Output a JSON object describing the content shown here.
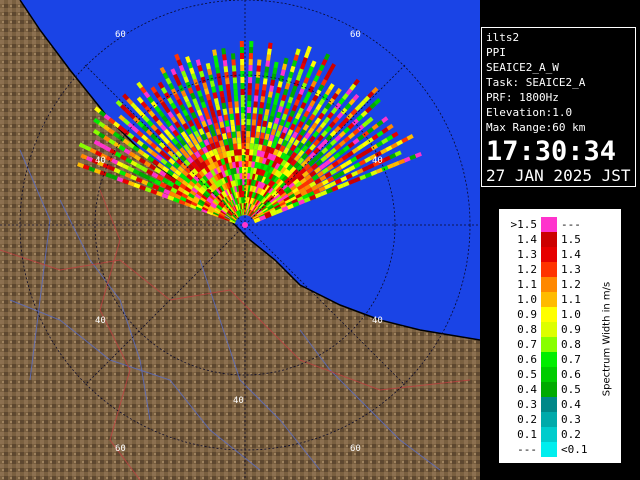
{
  "info": {
    "station": "ilts2",
    "scan_type": "PPI",
    "scan_name": "SEAICE2_A_W",
    "task": "Task: SEAICE2_A",
    "prf": "PRF: 1800Hz",
    "elevation": "Elevation:1.0",
    "max_range": "Max Range:60 km",
    "time": "17:30:34",
    "date": "27 JAN 2025 JST"
  },
  "legend": {
    "title": "Spectrum Width in m/s",
    "rows": [
      {
        "lo": ">1.5",
        "color": "#ff33cc",
        "hi": "---"
      },
      {
        "lo": "1.4",
        "color": "#cc0000",
        "hi": "1.5"
      },
      {
        "lo": "1.3",
        "color": "#e60000",
        "hi": "1.4"
      },
      {
        "lo": "1.2",
        "color": "#ff3300",
        "hi": "1.3"
      },
      {
        "lo": "1.1",
        "color": "#ff8800",
        "hi": "1.2"
      },
      {
        "lo": "1.0",
        "color": "#ffbb00",
        "hi": "1.1"
      },
      {
        "lo": "0.9",
        "color": "#ffff00",
        "hi": "1.0"
      },
      {
        "lo": "0.8",
        "color": "#ddff00",
        "hi": "0.9"
      },
      {
        "lo": "0.7",
        "color": "#88ff00",
        "hi": "0.8"
      },
      {
        "lo": "0.6",
        "color": "#00ee00",
        "hi": "0.7"
      },
      {
        "lo": "0.5",
        "color": "#00cc00",
        "hi": "0.6"
      },
      {
        "lo": "0.4",
        "color": "#00aa00",
        "hi": "0.5"
      },
      {
        "lo": "0.3",
        "color": "#008888",
        "hi": "0.4"
      },
      {
        "lo": "0.2",
        "color": "#00aaaa",
        "hi": "0.3"
      },
      {
        "lo": "0.1",
        "color": "#00cccc",
        "hi": "0.2"
      },
      {
        "lo": "---",
        "color": "#00eeee",
        "hi": "<0.1"
      }
    ]
  },
  "map": {
    "sea_color": "#1a44e6",
    "land_color": "#7a6040",
    "ring_labels": [
      "40",
      "60",
      "40",
      "40",
      "60",
      "40",
      "40",
      "60",
      "60"
    ]
  }
}
